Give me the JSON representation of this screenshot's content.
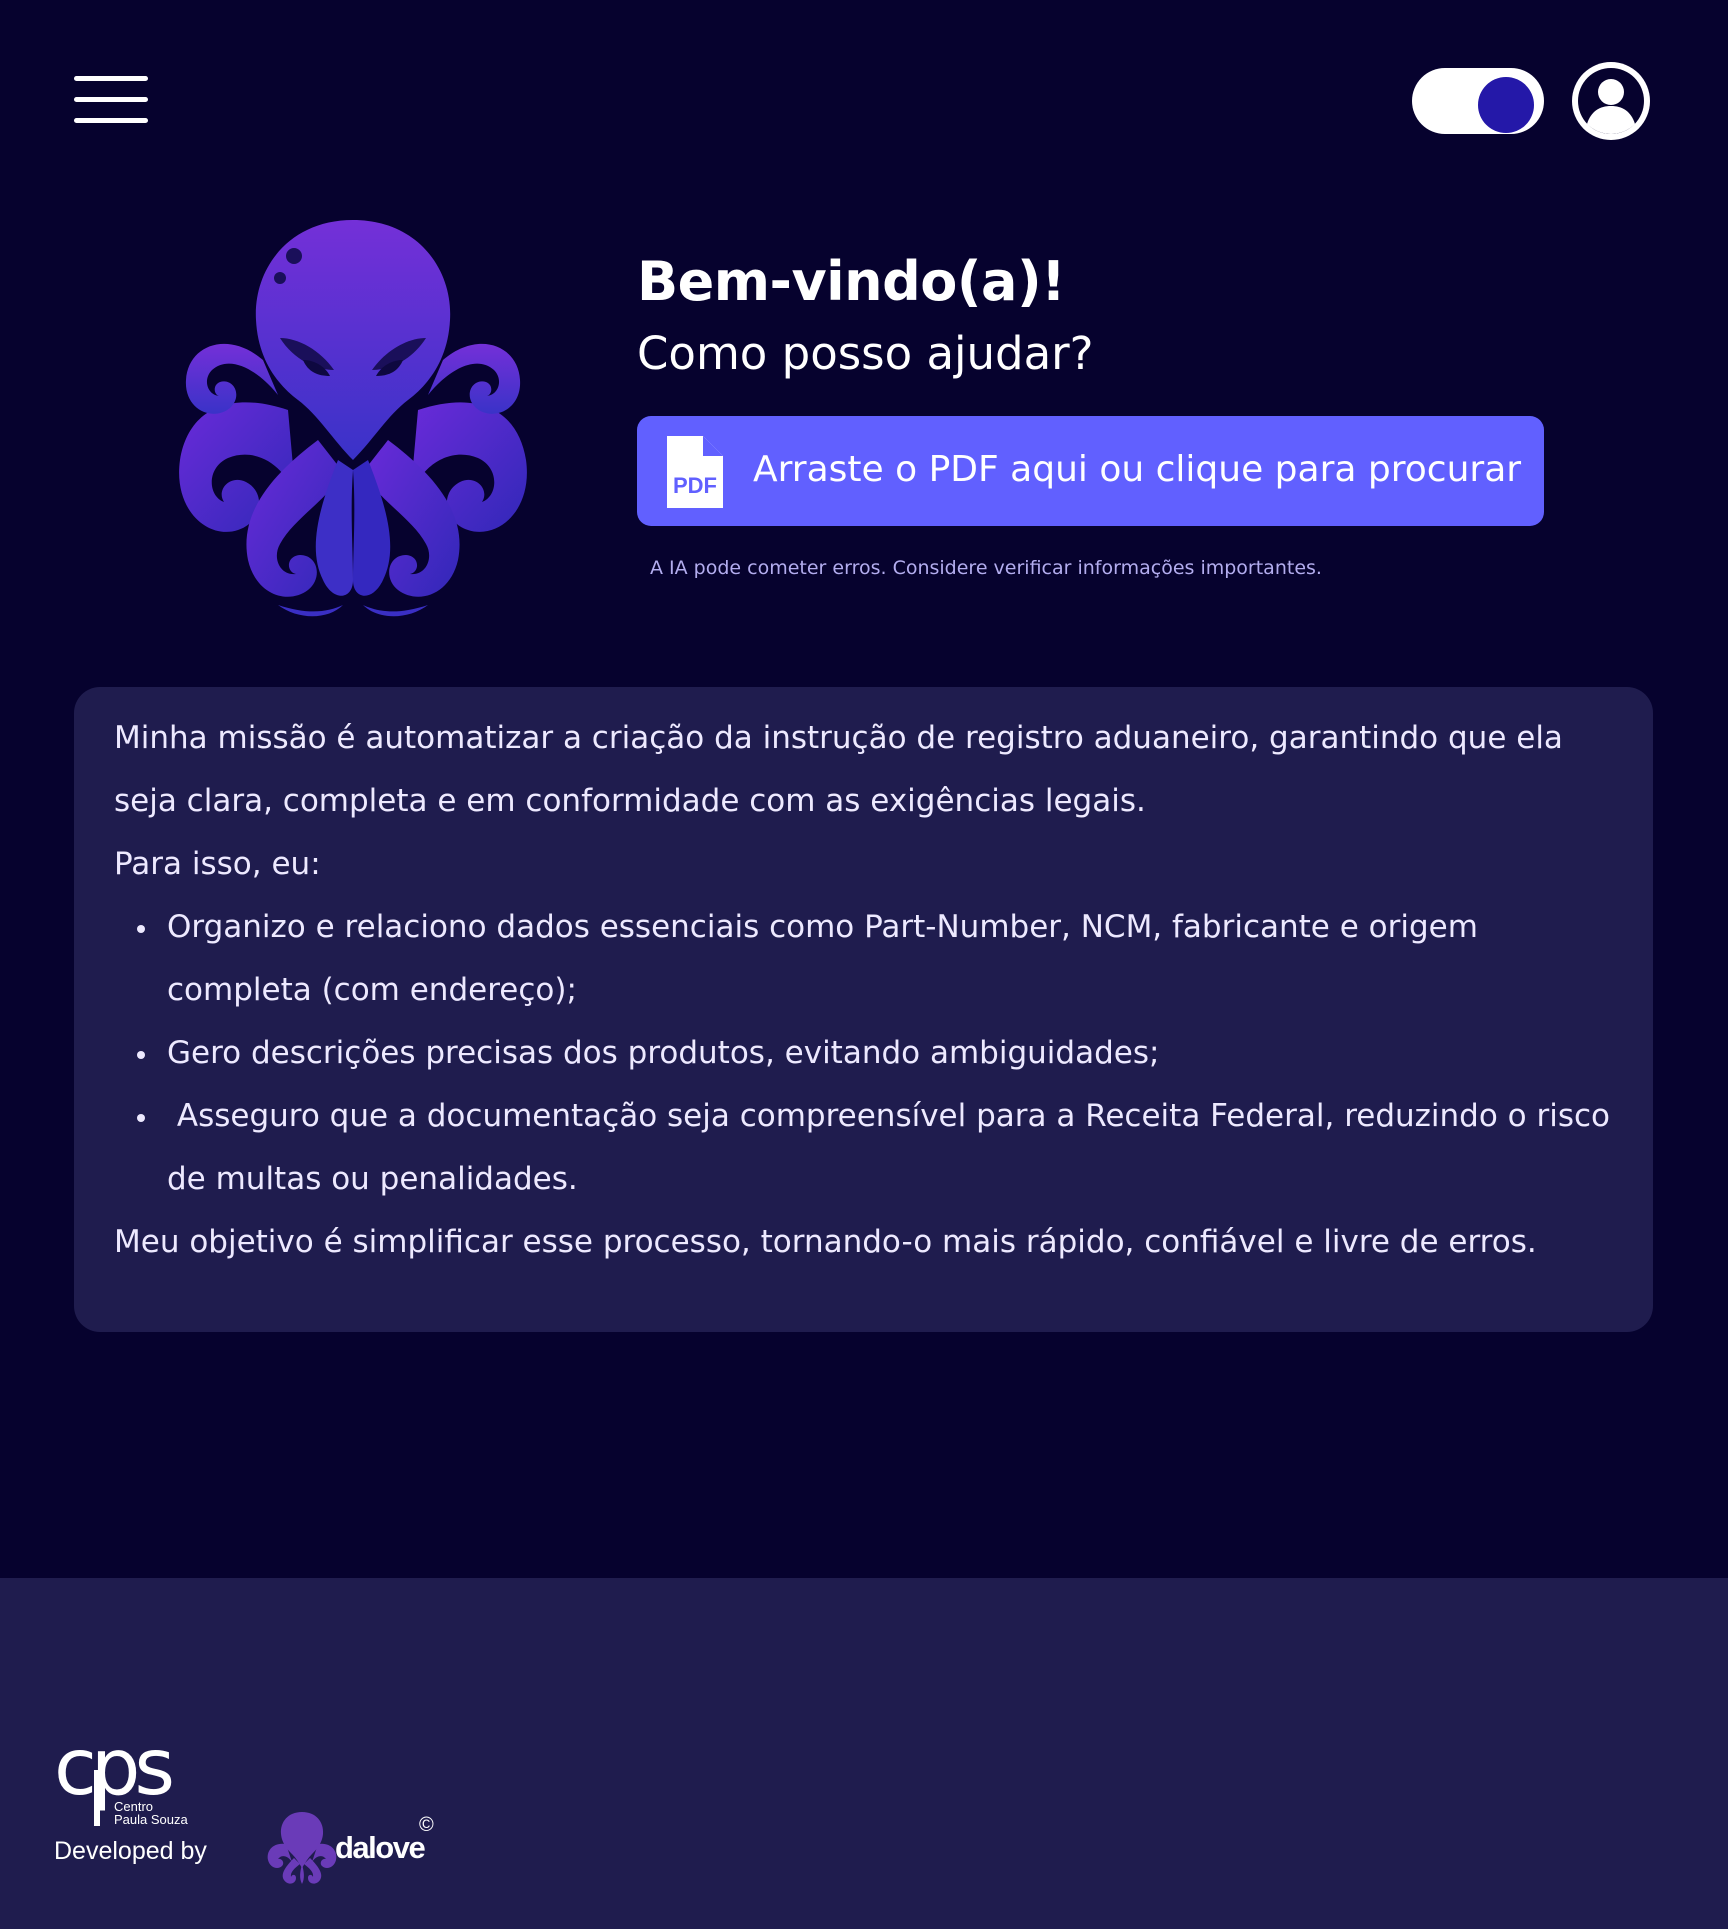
{
  "header": {
    "menu_icon": "hamburger-menu-icon",
    "theme_toggle_icon": "toggle-switch-icon",
    "user_icon": "user-circle-icon"
  },
  "hero": {
    "mascot_icon": "octopus-mascot-icon",
    "title": "Bem-vindo(a)!",
    "subtitle": "Como posso ajudar?",
    "upload": {
      "label": "Arraste o PDF aqui ou clique para procurar",
      "icon_text": "PDF",
      "icon": "pdf-file-icon"
    },
    "disclaimer": "A IA pode cometer erros. Considere verificar informações importantes."
  },
  "mission": {
    "intro": "Minha missão é automatizar a criação da instrução de registro aduaneiro, garantindo que ela seja clara, completa e em conformidade com as exigências legais.",
    "lead": "Para isso, eu:",
    "items": [
      "Organizo e relaciono dados essenciais como Part-Number, NCM, fabricante e origem completa (com endereço);",
      "Gero descrições precisas dos produtos, evitando ambiguidades;",
      " Asseguro que a documentação seja compreensível para a Receita Federal, reduzindo o risco de multas ou penalidades."
    ],
    "closing": "Meu objetivo é simplificar esse processo, tornando-o mais rápido, confiável e livre de erros."
  },
  "footer": {
    "cps_logo_text": "cps",
    "cps_subtitle_line1": "Centro",
    "cps_subtitle_line2": "Paula Souza",
    "developed_by": "Developed by",
    "dalove_name": "dalove",
    "dalove_mark": "©"
  },
  "colors": {
    "background": "#06022e",
    "card": "#1f1c4e",
    "accent": "#6160ff",
    "toggle_knob": "#2418a8",
    "mascot_purple": "#6a2bd9",
    "mascot_blue": "#3b2fc9"
  }
}
